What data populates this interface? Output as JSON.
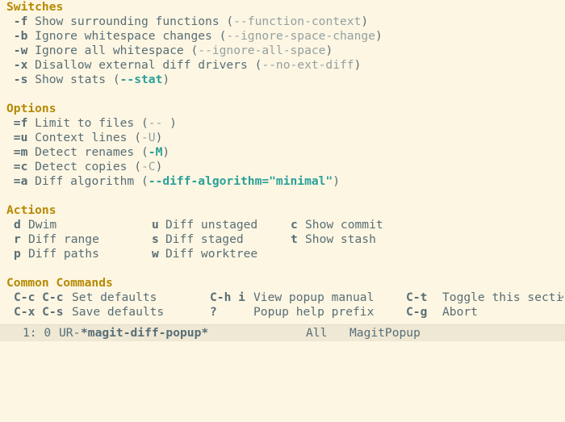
{
  "switches": {
    "heading": "Switches",
    "items": [
      {
        "key": "-f",
        "desc": "Show surrounding functions",
        "arg": "--function-context",
        "active": false
      },
      {
        "key": "-b",
        "desc": "Ignore whitespace changes",
        "arg": "--ignore-space-change",
        "active": false
      },
      {
        "key": "-w",
        "desc": "Ignore all whitespace",
        "arg": "--ignore-all-space",
        "active": false
      },
      {
        "key": "-x",
        "desc": "Disallow external diff drivers",
        "arg": "--no-ext-diff",
        "active": false
      },
      {
        "key": "-s",
        "desc": "Show stats",
        "arg": "--stat",
        "active": true
      }
    ]
  },
  "options": {
    "heading": "Options",
    "items": [
      {
        "key": "=f",
        "desc": "Limit to files",
        "arg": "-- ",
        "active": false
      },
      {
        "key": "=u",
        "desc": "Context lines",
        "arg": "-U",
        "active": false
      },
      {
        "key": "=m",
        "desc": "Detect renames",
        "arg": "-M",
        "active": true
      },
      {
        "key": "=c",
        "desc": "Detect copies",
        "arg": "-C",
        "active": false
      },
      {
        "key": "=a",
        "desc": "Diff algorithm",
        "arg": "--diff-algorithm=\"minimal\"",
        "active": true
      }
    ]
  },
  "actions": {
    "heading": "Actions",
    "rows": [
      [
        {
          "key": "d",
          "desc": "Dwim"
        },
        {
          "key": "u",
          "desc": "Diff unstaged"
        },
        {
          "key": "c",
          "desc": "Show commit"
        }
      ],
      [
        {
          "key": "r",
          "desc": "Diff range"
        },
        {
          "key": "s",
          "desc": "Diff staged"
        },
        {
          "key": "t",
          "desc": "Show stash"
        }
      ],
      [
        {
          "key": "p",
          "desc": "Diff paths"
        },
        {
          "key": "w",
          "desc": "Diff worktree"
        }
      ]
    ]
  },
  "common": {
    "heading": "Common Commands",
    "rows": [
      [
        {
          "key": "C-c C-c",
          "desc": "Set defaults"
        },
        {
          "key": "C-h i",
          "desc": "View popup manual"
        },
        {
          "key": "C-t",
          "desc": "Toggle this secti"
        }
      ],
      [
        {
          "key": "C-x C-s",
          "desc": "Save defaults"
        },
        {
          "key": "?",
          "desc": "Popup help prefix"
        },
        {
          "key": "C-g",
          "desc": "Abort"
        }
      ]
    ],
    "truncation_glyph": "↩"
  },
  "modeline": {
    "line": "1: 0",
    "status": "UR-",
    "buffer": "*magit-diff-popup*",
    "position": "All",
    "mode": "MagitPopup"
  },
  "colors": {
    "background": "#fdf6e3",
    "heading": "#b58900",
    "active_arg": "#2aa198",
    "inactive_arg": "#93a1a1",
    "text": "#586e75",
    "modeline_bg": "#eee8d5"
  }
}
